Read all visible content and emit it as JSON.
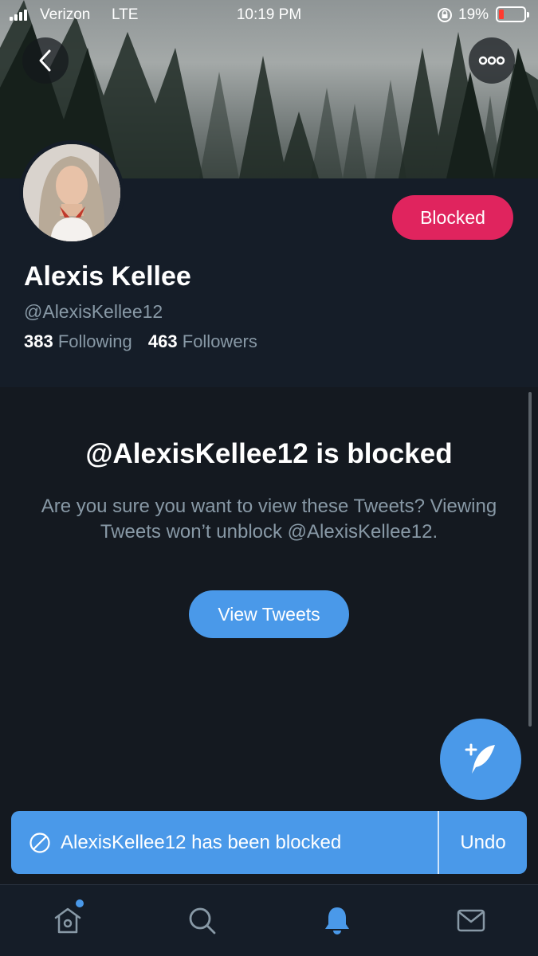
{
  "status_bar": {
    "carrier": "Verizon",
    "network": "LTE",
    "time": "10:19 PM",
    "battery": "19%",
    "battery_level": 0.19,
    "icons": [
      "signal-icon",
      "rotation-lock-icon",
      "battery-icon"
    ]
  },
  "header": {
    "back_icon": "chevron-left-icon",
    "more_icon": "more-horizontal-icon"
  },
  "profile": {
    "name": "Alexis Kellee",
    "handle": "@AlexisKellee12",
    "following_count": "383",
    "following_label": "Following",
    "followers_count": "463",
    "followers_label": "Followers",
    "blocked_button": "Blocked"
  },
  "blocked_notice": {
    "title": "@AlexisKellee12 is blocked",
    "message": "Are you sure you want to view these Tweets? Viewing Tweets won’t unblock @AlexisKellee12.",
    "button": "View Tweets"
  },
  "snackbar": {
    "text": "AlexisKellee12 has been blocked",
    "action": "Undo",
    "icon": "blocked-icon"
  },
  "tabs": [
    {
      "name": "home",
      "icon": "home-icon",
      "active": false,
      "badge": true
    },
    {
      "name": "search",
      "icon": "search-icon",
      "active": false
    },
    {
      "name": "notifications",
      "icon": "bell-icon",
      "active": true
    },
    {
      "name": "messages",
      "icon": "mail-icon",
      "active": false
    }
  ],
  "colors": {
    "accent": "#4a99e9",
    "blocked": "#e0245e",
    "background": "#141a22",
    "muted_text": "#8899a6"
  }
}
